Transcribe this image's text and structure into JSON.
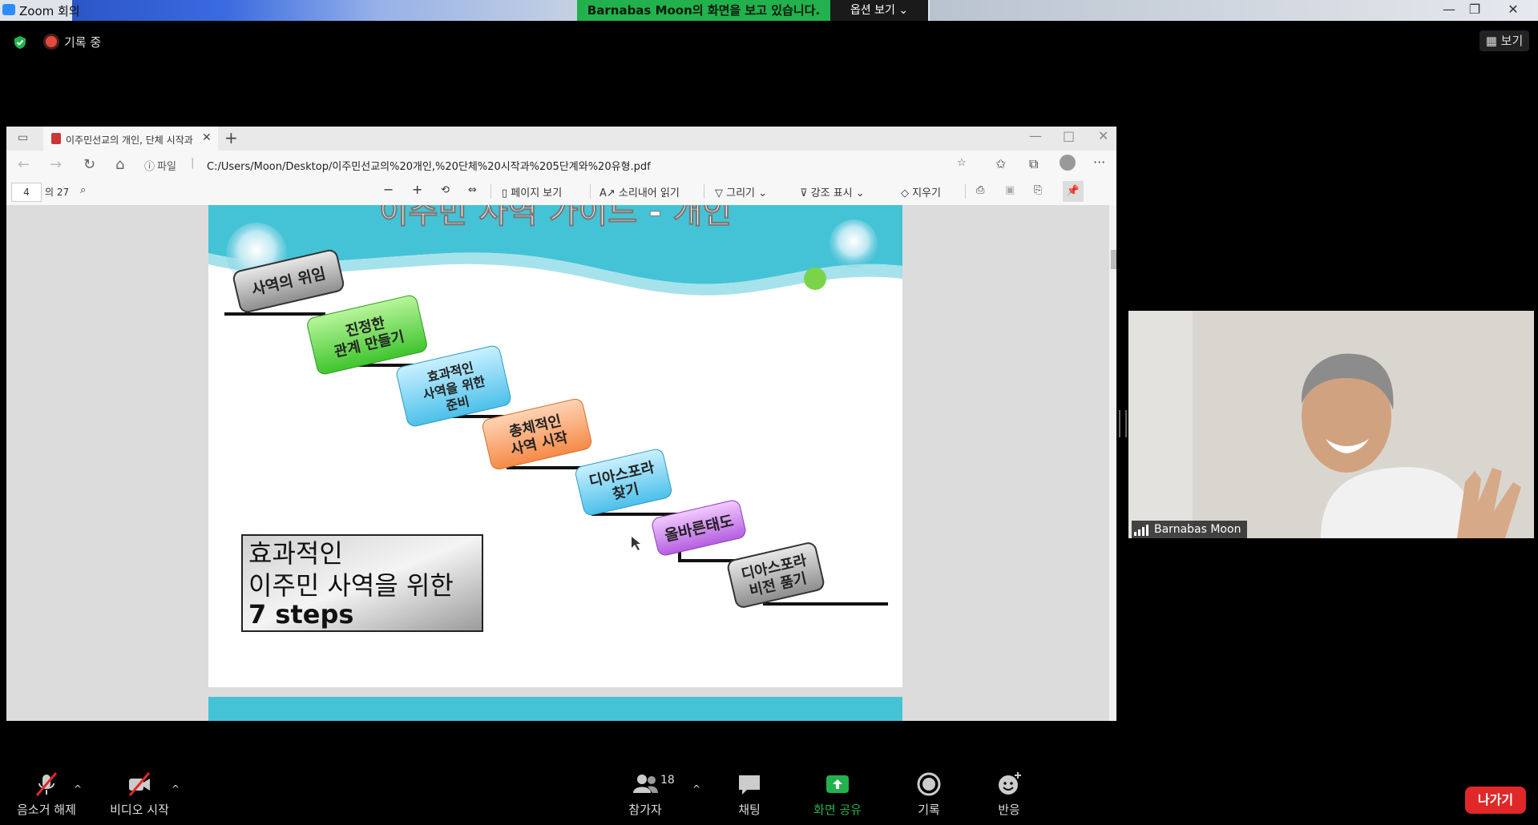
{
  "zoom": {
    "window_title": "Zoom 회의",
    "share_banner": "Barnabas  Moon의 화면을 보고 있습니다.",
    "view_options": "옵션 보기",
    "recording_label": "기록 중",
    "view_button": "보기"
  },
  "browser": {
    "tab_title": "이주민선교의 개인, 단체 시작과",
    "url_prefix": "파일",
    "url": "C:/Users/Moon/Desktop/이주민선교의%20개인,%20단체%20시작과%205단계와%20유형.pdf"
  },
  "pdf_toolbar": {
    "page_number": "4",
    "page_total": "의 27",
    "page_view": "페이지 보기",
    "read_aloud": "소리내어 읽기",
    "draw": "그리기",
    "highlight": "강조 표시",
    "erase": "지우기"
  },
  "slide": {
    "title": "이주민 사역 가이드 - 개인",
    "steps": [
      "사역의 위임",
      "진정한|관계 만들기",
      "효과적인|사역을 위한|준비",
      "총체적인|사역 시작",
      "디아스포라|찾기",
      "올바른태도",
      "디아스포라|비전 품기"
    ],
    "box_line1": "효과적인",
    "box_line2": "이주민 사역을 위한",
    "box_line3": "7 steps"
  },
  "video": {
    "participant_name": "Barnabas Moon"
  },
  "toolbar": {
    "unmute": "음소거 해제",
    "start_video": "비디오 시작",
    "participants": "참가자",
    "participants_count": "18",
    "chat": "채팅",
    "share_screen": "화면 공유",
    "record": "기록",
    "reactions": "반응",
    "leave": "나가기"
  },
  "colors": {
    "share_green": "#23b14d",
    "leave_red": "#e02828",
    "slide_teal": "#45c3d6"
  }
}
